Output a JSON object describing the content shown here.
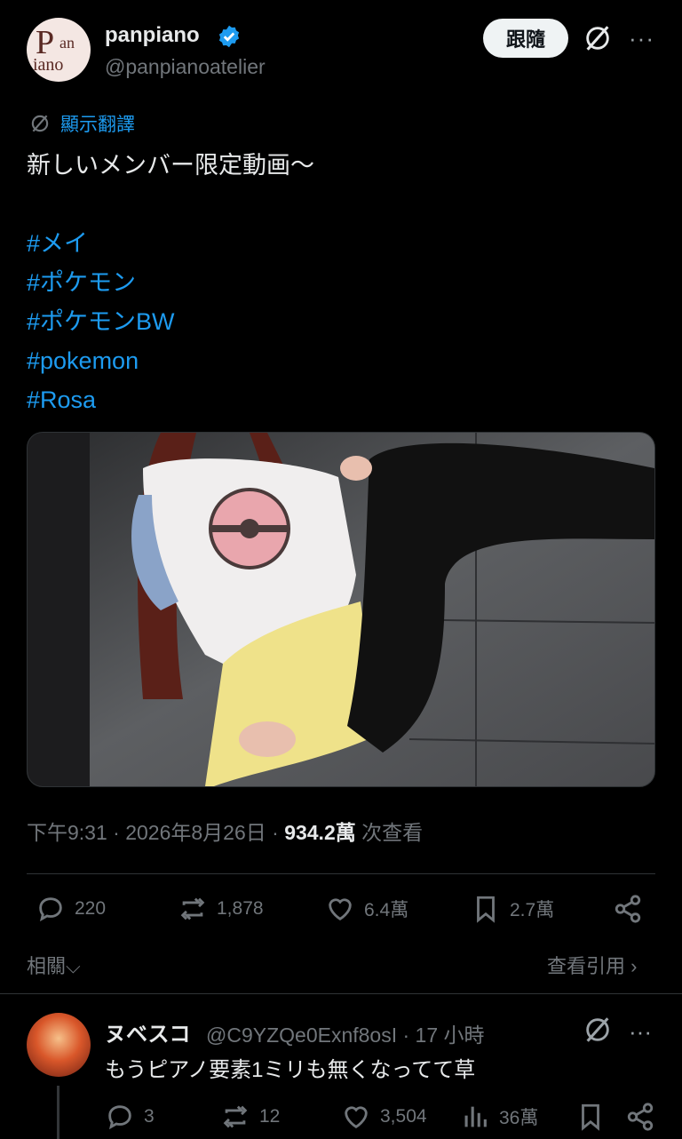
{
  "author": {
    "name": "panpiano",
    "handle": "@panpianoatelier",
    "avatar_text": [
      "P",
      "an",
      "iano"
    ]
  },
  "header": {
    "follow_label": "跟隨",
    "more_label": "···"
  },
  "translate_label": "顯示翻譯",
  "tweet": {
    "text": "新しいメンバー限定動画〜",
    "hashtags": [
      "#メイ",
      "#ポケモン",
      "#ポケモンBW",
      "#pokemon",
      "#Rosa"
    ]
  },
  "meta": {
    "time_date": "下午9:31 · 2026年8月26日 · ",
    "views": "934.2萬",
    "views_label": " 次查看"
  },
  "actions": {
    "replies": "220",
    "reposts": "1,878",
    "likes": "6.4萬",
    "bookmarks": "2.7萬"
  },
  "related_label": "相關⌵",
  "quotes_label": "查看引用 ›",
  "reply": {
    "name": "ヌベスコ",
    "handle_time": "@C9YZQe0Exnf8osI · 17 小時",
    "text": "もうピアノ要素1ミリも無くなってて草",
    "replies": "3",
    "reposts": "12",
    "likes": "3,504",
    "views": "36萬"
  },
  "colors": {
    "accent": "#1d9bf0",
    "muted": "#71767b",
    "text": "#e7e9ea"
  }
}
